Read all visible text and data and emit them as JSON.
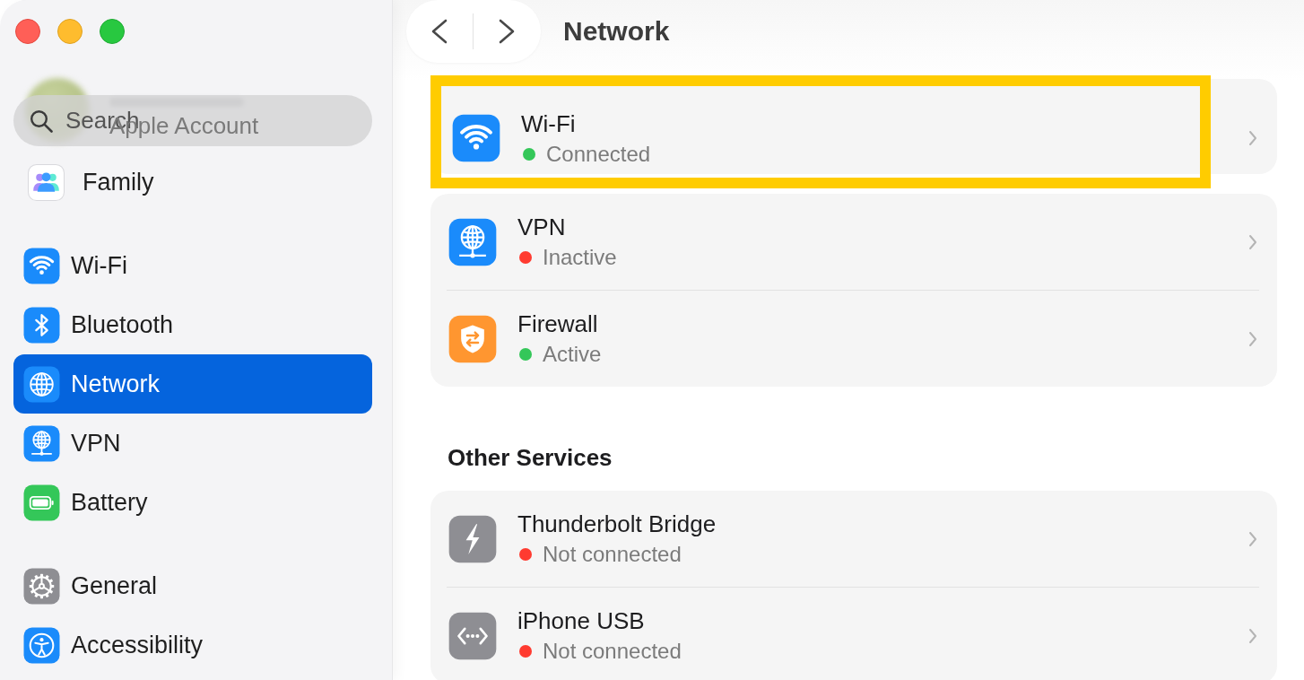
{
  "sidebar": {
    "account": {
      "label": "Apple Account"
    },
    "search": {
      "placeholder": "Search"
    },
    "groups": [
      {
        "items": [
          {
            "kind": "family",
            "label": "Family",
            "selected": false
          }
        ]
      },
      {
        "items": [
          {
            "kind": "wifi",
            "label": "Wi-Fi",
            "selected": false
          },
          {
            "kind": "bluetooth",
            "label": "Bluetooth",
            "selected": false
          },
          {
            "kind": "network",
            "label": "Network",
            "selected": true
          },
          {
            "kind": "vpn",
            "label": "VPN",
            "selected": false
          },
          {
            "kind": "battery",
            "label": "Battery",
            "selected": false
          }
        ]
      },
      {
        "items": [
          {
            "kind": "general",
            "label": "General",
            "selected": false
          },
          {
            "kind": "accessibility",
            "label": "Accessibility",
            "selected": false
          }
        ]
      }
    ]
  },
  "main": {
    "title": "Network",
    "sections": [
      {
        "cards": [
          {
            "services": [
              {
                "kind": "wifi",
                "name": "Wi-Fi",
                "status": "Connected",
                "color": "#34c759",
                "highlighted": true
              }
            ]
          },
          {
            "services": [
              {
                "kind": "vpn",
                "name": "VPN",
                "status": "Inactive",
                "color": "#ff3b30",
                "highlighted": false
              },
              {
                "kind": "firewall",
                "name": "Firewall",
                "status": "Active",
                "color": "#34c759",
                "highlighted": false
              }
            ]
          }
        ]
      },
      {
        "title": "Other Services",
        "cards": [
          {
            "services": [
              {
                "kind": "thunderbolt",
                "name": "Thunderbolt Bridge",
                "status": "Not connected",
                "color": "#ff3b30",
                "highlighted": false
              },
              {
                "kind": "usb",
                "name": "iPhone USB",
                "status": "Not connected",
                "color": "#ff3b30",
                "highlighted": false
              }
            ]
          }
        ]
      }
    ]
  }
}
